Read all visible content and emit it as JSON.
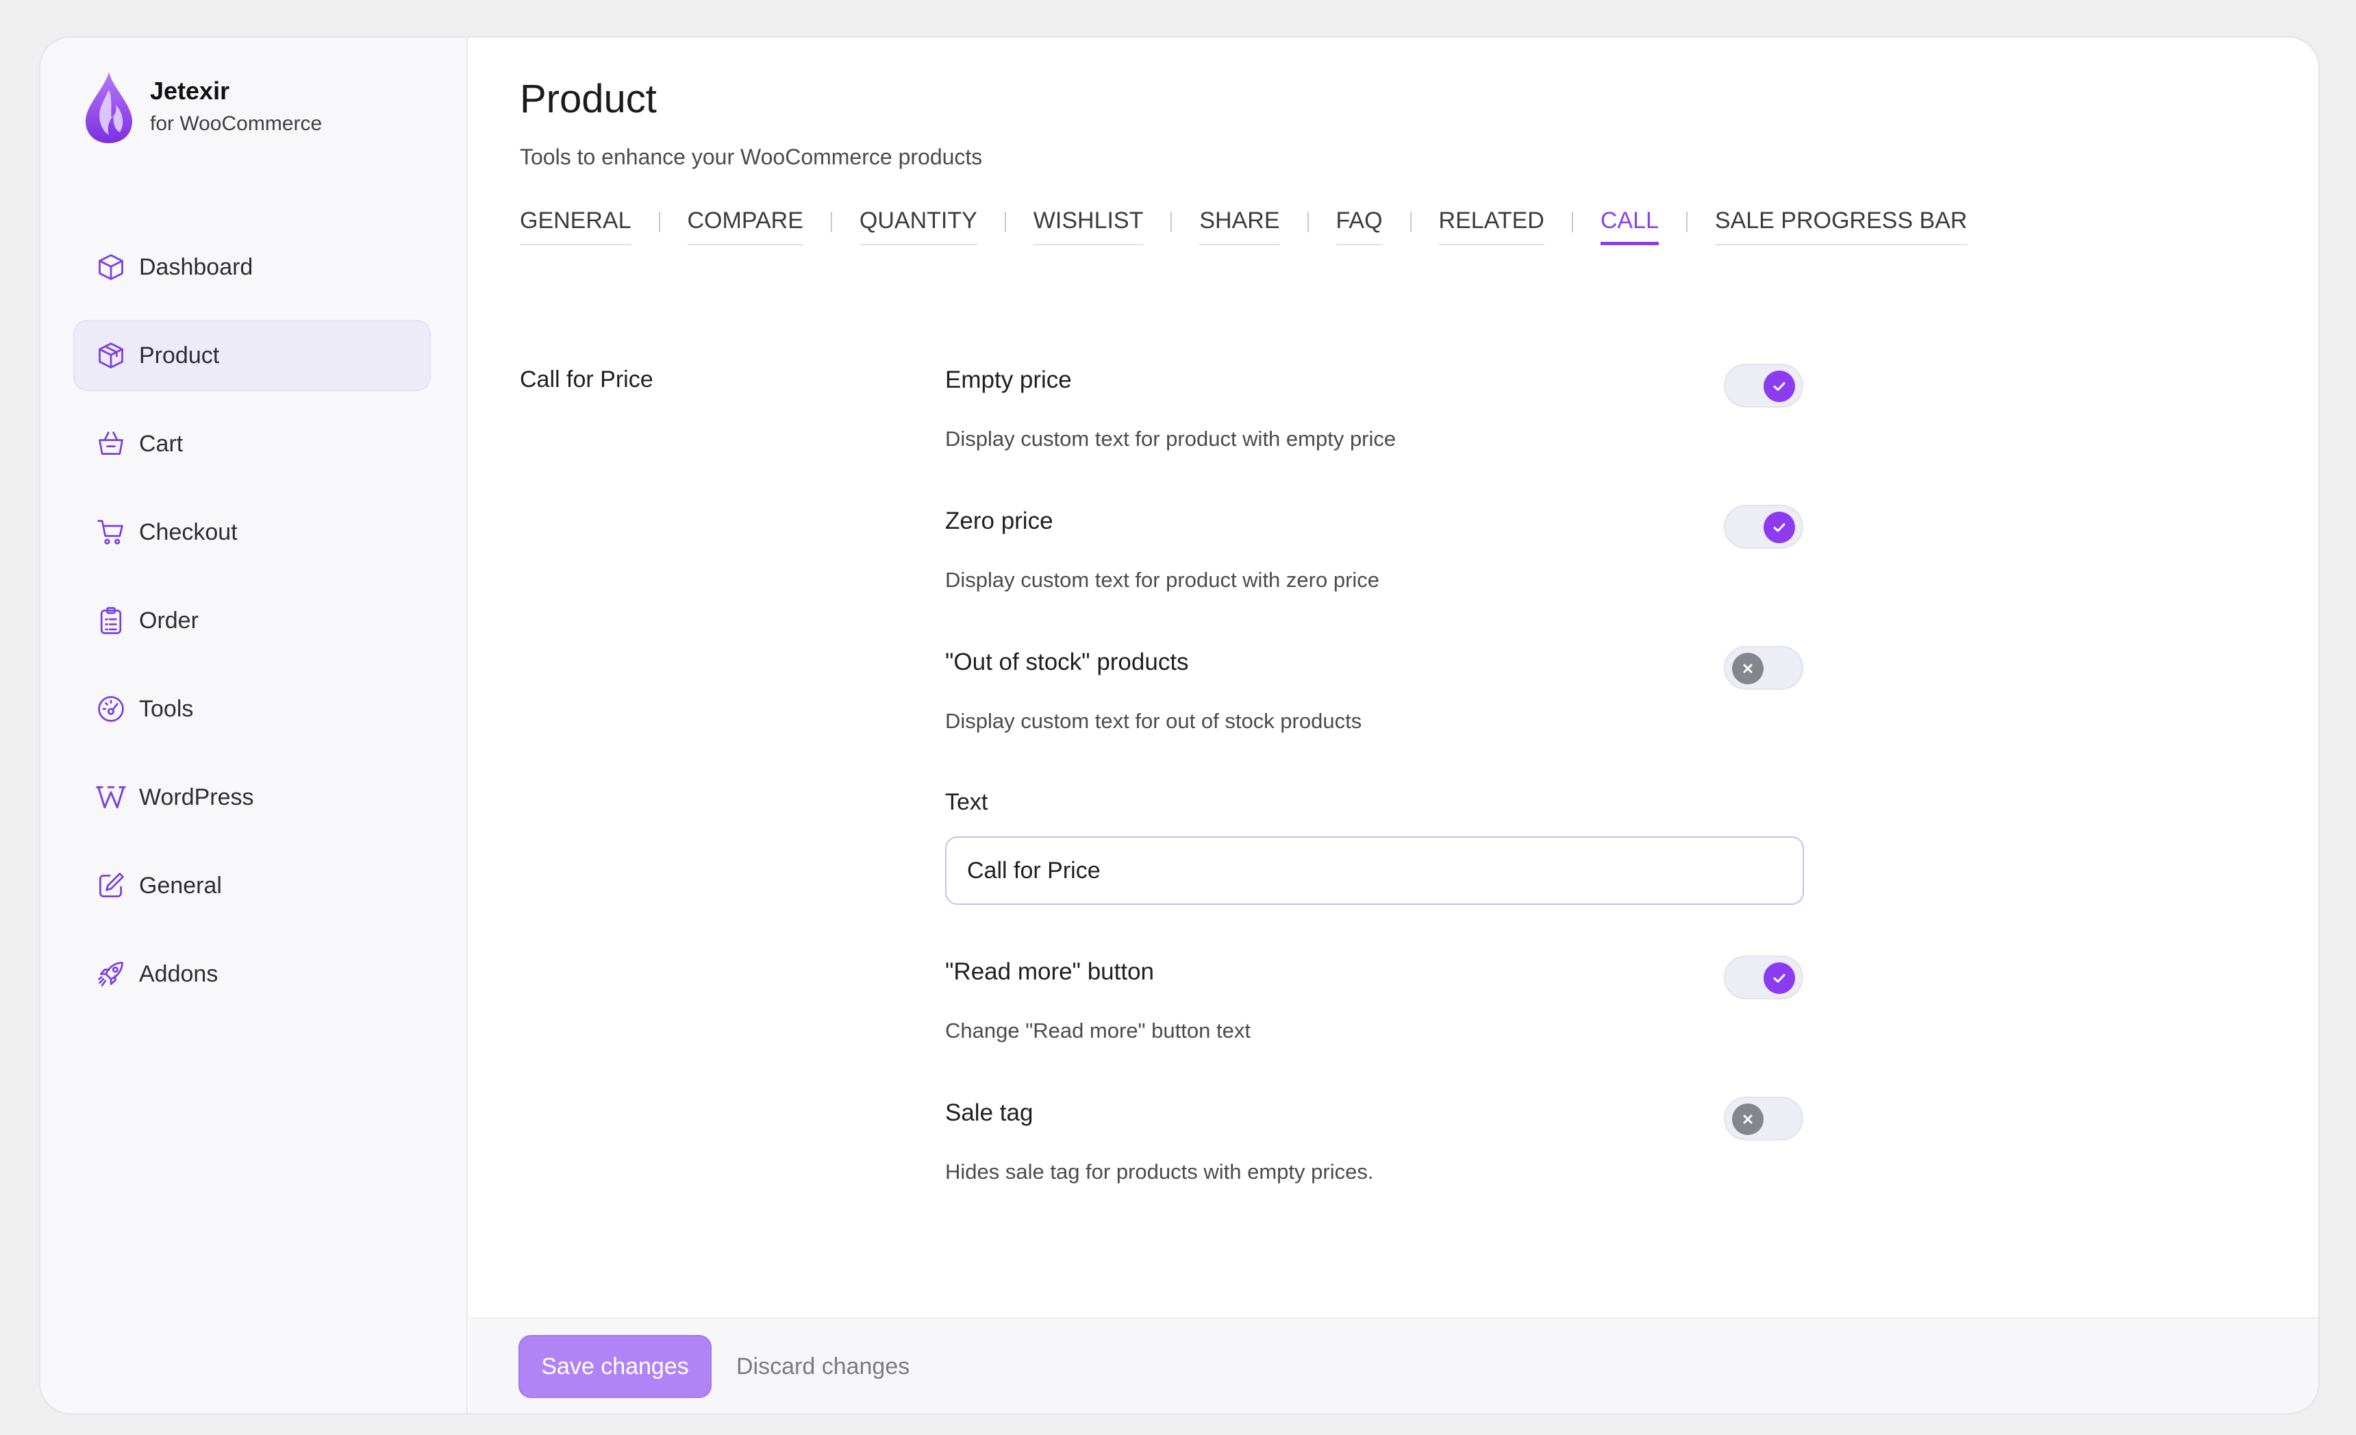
{
  "brand": {
    "name": "Jetexir",
    "subtitle": "for WooCommerce"
  },
  "sidebar": {
    "items": [
      {
        "label": "Dashboard",
        "icon": "cube-icon"
      },
      {
        "label": "Product",
        "icon": "box-icon",
        "active": true
      },
      {
        "label": "Cart",
        "icon": "basket-icon"
      },
      {
        "label": "Checkout",
        "icon": "cart-icon"
      },
      {
        "label": "Order",
        "icon": "clipboard-list-icon"
      },
      {
        "label": "Tools",
        "icon": "gauge-icon"
      },
      {
        "label": "WordPress",
        "icon": "wordpress-icon"
      },
      {
        "label": "General",
        "icon": "edit-icon"
      },
      {
        "label": "Addons",
        "icon": "rocket-icon"
      }
    ]
  },
  "page": {
    "title": "Product",
    "subtitle": "Tools to enhance your WooCommerce products"
  },
  "tabs": [
    "GENERAL",
    "COMPARE",
    "QUANTITY",
    "WISHLIST",
    "SHARE",
    "FAQ",
    "RELATED",
    "CALL",
    "SALE PROGRESS BAR"
  ],
  "active_tab": "CALL",
  "section": {
    "label": "Call for Price"
  },
  "settings": {
    "empty_price": {
      "title": "Empty price",
      "desc": "Display custom text for product with empty price",
      "enabled": true
    },
    "zero_price": {
      "title": "Zero price",
      "desc": "Display custom text for product with zero price",
      "enabled": true
    },
    "out_of_stock": {
      "title": "\"Out of stock\" products",
      "desc": "Display custom text for out of stock products",
      "enabled": false
    },
    "text": {
      "label": "Text",
      "value": "Call for Price"
    },
    "read_more": {
      "title": "\"Read more\" button",
      "desc": "Change \"Read more\" button text",
      "enabled": true
    },
    "sale_tag": {
      "title": "Sale tag",
      "desc": "Hides sale tag for products with empty prices.",
      "enabled": false
    }
  },
  "footer": {
    "save_label": "Save changes",
    "discard_label": "Discard changes"
  },
  "colors": {
    "accent": "#8d3bf0",
    "save_button": "#b184f6",
    "toggle_off_knob": "#85858d"
  }
}
